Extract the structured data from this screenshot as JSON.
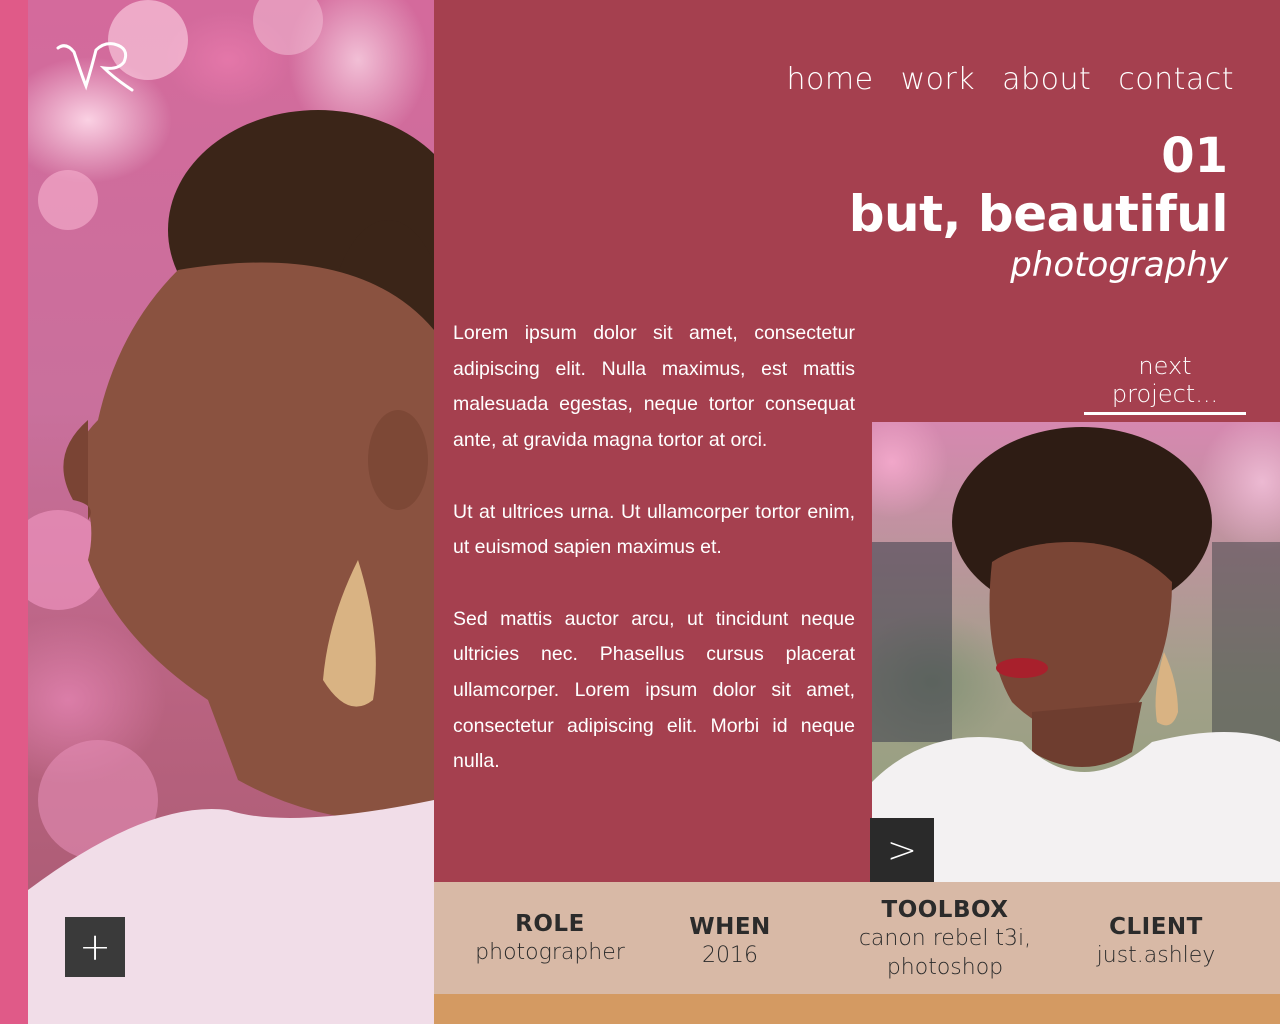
{
  "nav": {
    "items": [
      {
        "label": "home"
      },
      {
        "label": "work"
      },
      {
        "label": "about"
      },
      {
        "label": "contact"
      }
    ]
  },
  "project": {
    "number": "01",
    "title": "but, beautiful",
    "subtitle": "photography",
    "next_label": "next project..."
  },
  "body": {
    "paragraphs": [
      "Lorem ipsum dolor sit amet, consectetur adipiscing elit. Nulla maximus, est mattis malesuada egestas, neque tortor consequat ante, at gravida magna tortor at orci.",
      "Ut at ultrices urna. Ut ullamcorper tortor enim, ut euismod sapien maximus et.",
      "Sed mattis auctor arcu, ut tincidunt neque ultricies nec. Phasellus cursus placerat ullamcorper. Lorem ipsum dolor sit amet, consectetur adipiscing elit. Morbi id neque nulla."
    ]
  },
  "buttons": {
    "plus": "+",
    "next_arrow": ">"
  },
  "info": {
    "role": {
      "label": "ROLE",
      "value": "photographer"
    },
    "when": {
      "label": "WHEN",
      "value": "2016"
    },
    "toolbox": {
      "label": "TOOLBOX",
      "value_line1": "canon rebel t3i,",
      "value_line2": "photoshop"
    },
    "client": {
      "label": "CLIENT",
      "value": "just.ashley"
    }
  },
  "colors": {
    "background": "#a5404f",
    "left_strip": "#e05a88",
    "info_bar": "#d8b9a6",
    "bottom_bar": "#d49a62",
    "button_dark": "#3a3a3a"
  },
  "icons": {
    "logo": "vr-monogram-logo",
    "plus": "plus-icon",
    "next": "chevron-right-icon"
  }
}
